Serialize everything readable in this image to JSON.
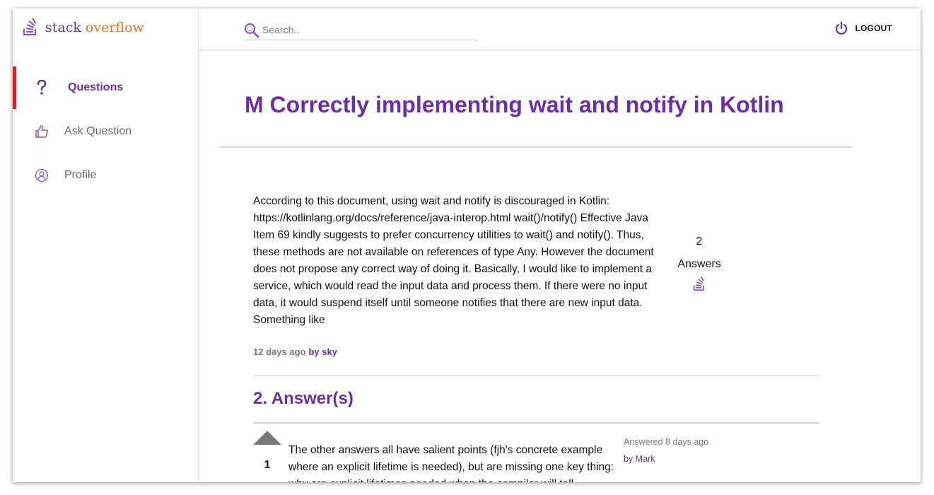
{
  "brand": {
    "part1": "stack",
    "part2": "overflow"
  },
  "sidebar": {
    "items": [
      {
        "label": "Questions",
        "icon": "question-icon",
        "active": true
      },
      {
        "label": "Ask Question",
        "icon": "thumbs-up-icon",
        "active": false
      },
      {
        "label": "Profile",
        "icon": "user-icon",
        "active": false
      }
    ]
  },
  "header": {
    "search_placeholder": "Search..",
    "logout_label": "LOGOUT"
  },
  "question": {
    "title": "M Correctly implementing wait and notify in Kotlin",
    "body": "According to this document, using wait and notify is discouraged in Kotlin: https://kotlinlang.org/docs/reference/java-interop.html wait()/notify() Effective Java Item 69 kindly suggests to prefer concurrency utilities to wait() and notify(). Thus, these methods are not available on references of type Any. However the document does not propose any correct way of doing it. Basically, I would like to implement a service, which would read the input data and process them. If there were no input data, it would suspend itself until someone notifies that there are new input data. Something like",
    "answer_count": "2",
    "answers_label": "Answers",
    "time_ago": "12 days ago",
    "author": "by sky"
  },
  "answers_section": {
    "heading": "2. Answer(s)"
  },
  "answers": [
    {
      "votes": "1",
      "body": "The other answers all have salient points (fjh's concrete example where an explicit lifetime is needed), but are missing one key thing: why are explicit lifetimes needed when the compiler will tell",
      "answered": "Answered 8 days ago",
      "author": "by Mark"
    }
  ],
  "colors": {
    "accent": "#6b2fa3",
    "active_marker": "#ea1b1b",
    "logo_orange": "#e8722a"
  }
}
